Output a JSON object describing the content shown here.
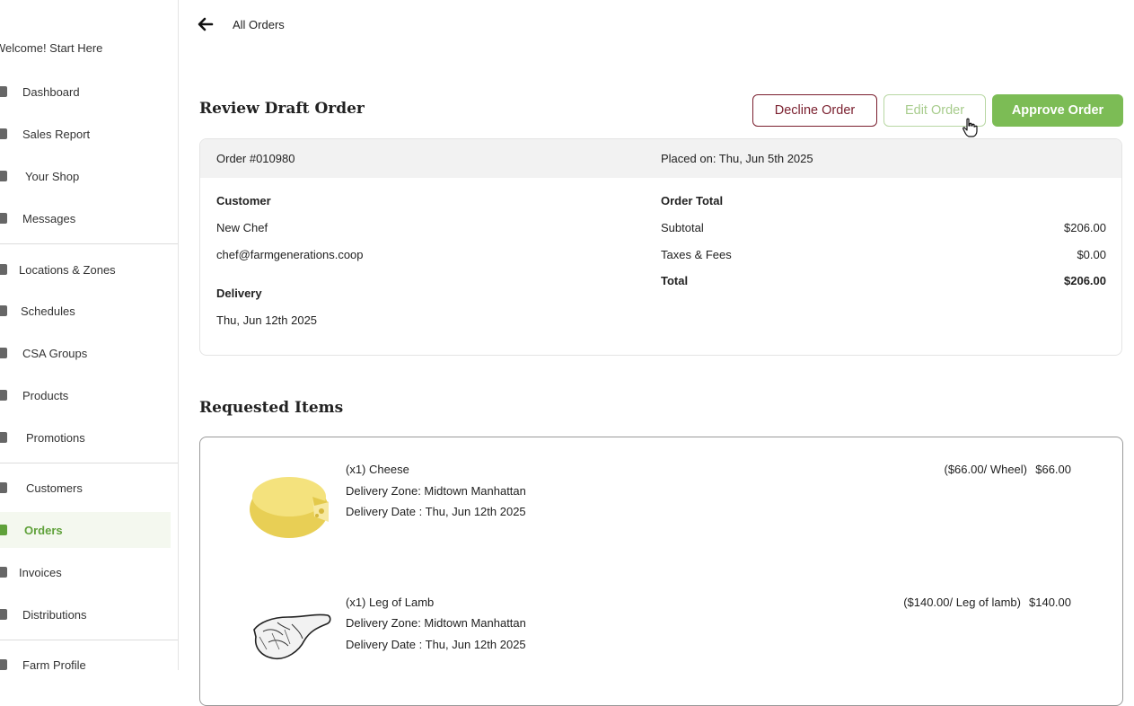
{
  "sidebar": {
    "welcome": "Welcome! Start Here",
    "items": [
      {
        "label": "Dashboard",
        "icon": "dashboard-icon"
      },
      {
        "label": "Sales Report",
        "icon": "sales-report-icon"
      },
      {
        "label": "Your Shop",
        "icon": "shop-icon"
      },
      {
        "label": "Messages",
        "icon": "messages-icon"
      },
      {
        "label": "Locations & Zones",
        "icon": "location-pin-icon"
      },
      {
        "label": "Schedules",
        "icon": "calendar-icon"
      },
      {
        "label": "CSA Groups",
        "icon": "csa-groups-icon"
      },
      {
        "label": "Products",
        "icon": "products-icon"
      },
      {
        "label": "Promotions",
        "icon": "tag-icon"
      },
      {
        "label": "Customers",
        "icon": "customers-icon"
      },
      {
        "label": "Orders",
        "icon": "cart-icon",
        "active": true
      },
      {
        "label": "Invoices",
        "icon": "invoice-icon"
      },
      {
        "label": "Distributions",
        "icon": "list-icon"
      },
      {
        "label": "Farm Profile",
        "icon": "farm-profile-icon"
      }
    ]
  },
  "back_label": "All Orders",
  "title": "Review Draft Order",
  "buttons": {
    "decline": "Decline Order",
    "edit": "Edit Order",
    "approve": "Approve Order"
  },
  "order": {
    "number": "Order #010980",
    "placed": "Placed on: Thu, Jun 5th 2025",
    "customer_heading": "Customer",
    "customer_name": "New Chef",
    "customer_email": "chef@farmgenerations.coop",
    "delivery_heading": "Delivery",
    "delivery_date": "Thu, Jun 12th 2025",
    "total_heading": "Order Total",
    "subtotal_label": "Subtotal",
    "subtotal_value": "$206.00",
    "taxes_label": "Taxes & Fees",
    "taxes_value": "$0.00",
    "total_label": "Total",
    "total_value": "$206.00"
  },
  "requested_title": "Requested Items",
  "items": [
    {
      "name": "(x1) Cheese",
      "zone": "Delivery Zone: Midtown Manhattan",
      "date": "Delivery Date : Thu, Jun 12th 2025",
      "unit_price": "($66.00/ Wheel)",
      "price": "$66.00"
    },
    {
      "name": "(x1) Leg of Lamb",
      "zone": "Delivery Zone: Midtown Manhattan",
      "date": "Delivery Date : Thu, Jun 12th 2025",
      "unit_price": "($140.00/ Leg of lamb)",
      "price": "$140.00"
    }
  ],
  "colors": {
    "accent_green": "#7cbc55",
    "decline_red": "#7a1f2e",
    "edit_disabled": "#a7cc8c"
  }
}
